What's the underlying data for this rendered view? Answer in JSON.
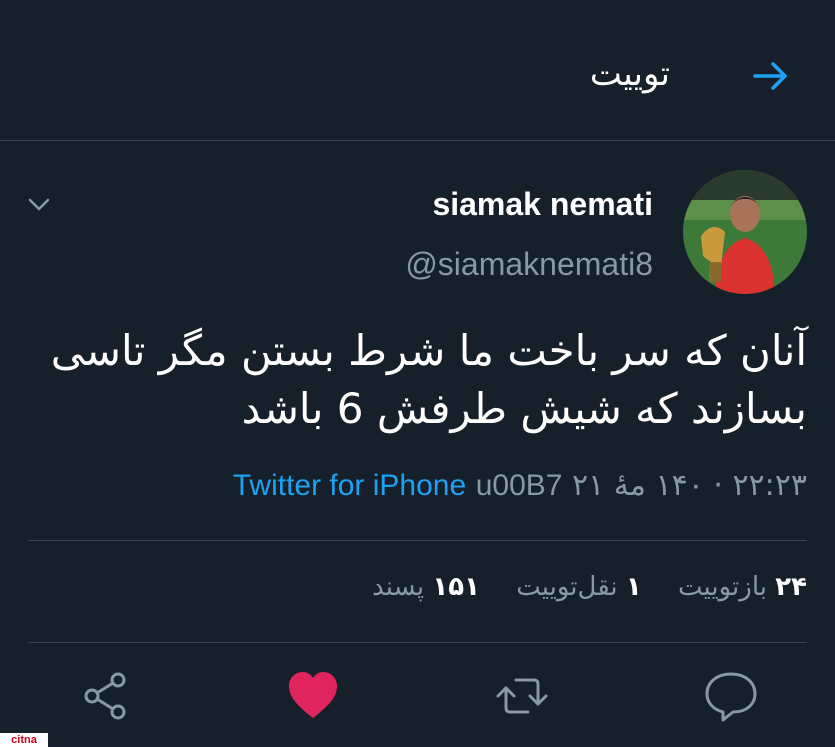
{
  "header": {
    "title": "توییت",
    "back_icon": "arrow-right-icon"
  },
  "tweet": {
    "display_name": "siamak nemati",
    "handle": "@siamaknemati8",
    "text": "آنان که سر باخت ما شرط بستن مگر تاسی بسازند که شیش طرفش 6 باشد",
    "time": "۲۲:۲۳ · ۱۴۰ مهٔ ۲۱",
    "separator": "u00B7",
    "source": "Twitter for iPhone"
  },
  "stats": {
    "retweets_count": "۲۴",
    "retweets_label": "بازتوییت",
    "quotes_count": "۱",
    "quotes_label": "نقل‌توییت",
    "likes_count": "۱۵۱",
    "likes_label": "پسند"
  },
  "actions": {
    "reply_icon": "comment-icon",
    "retweet_icon": "retweet-icon",
    "like_icon": "heart-icon",
    "share_icon": "share-icon"
  },
  "colors": {
    "background": "#15202b",
    "accent": "#1da1f2",
    "like": "#e0245e",
    "secondary_text": "#8899a6",
    "divider": "#38444d"
  },
  "watermark": "citna"
}
